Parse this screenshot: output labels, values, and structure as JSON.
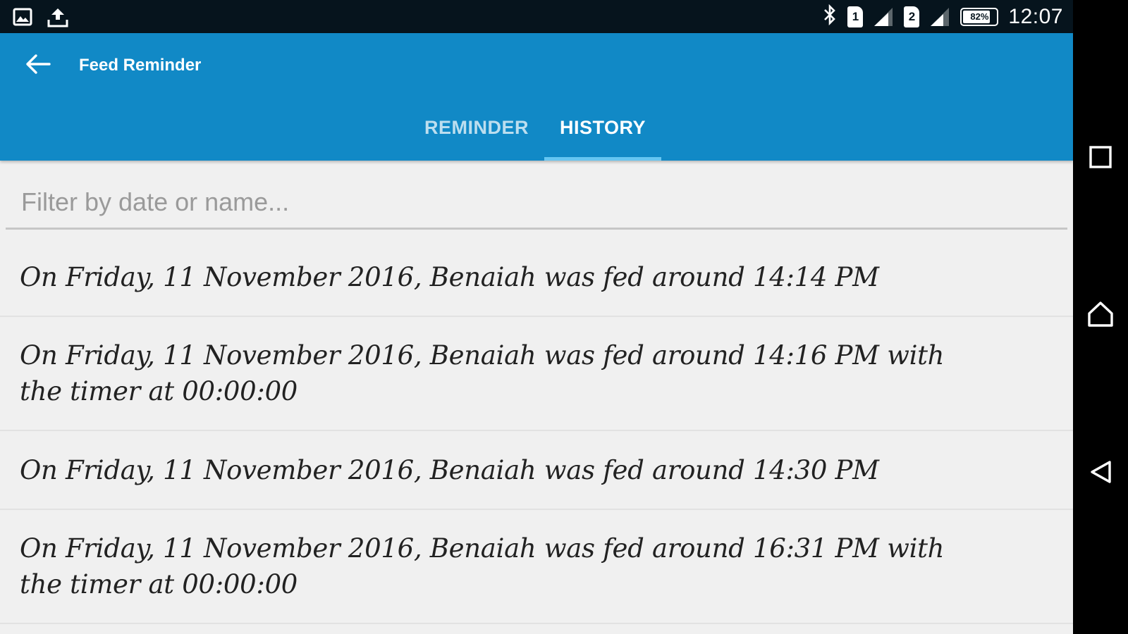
{
  "status_bar": {
    "time": "12:07",
    "battery_percent": "82%",
    "battery_level": 0.82,
    "sim1_label": "1",
    "sim2_label": "2",
    "icons": [
      "image-icon",
      "upload-icon",
      "bluetooth-icon",
      "sim1-icon",
      "signal1-icon",
      "sim2-icon",
      "signal2-icon",
      "battery-icon"
    ]
  },
  "app_bar": {
    "title": "Feed Reminder",
    "background_color": "#1189c6",
    "back_icon": "arrow-left-icon"
  },
  "tabs": [
    {
      "label": "REMINDER",
      "active": false
    },
    {
      "label": "HISTORY",
      "active": true
    }
  ],
  "filter": {
    "placeholder": "Filter by date or name...",
    "value": ""
  },
  "history": [
    {
      "text": "On Friday, 11 November 2016, Benaiah was fed around 14:14 PM"
    },
    {
      "text": "On Friday, 11 November 2016, Benaiah was fed around 14:16 PM with the timer at 00:00:00"
    },
    {
      "text": "On Friday, 11 November 2016, Benaiah was fed around 14:30 PM"
    },
    {
      "text": "On Friday, 11 November 2016, Benaiah was fed around 16:31 PM with the timer at 00:00:00"
    }
  ],
  "nav_bar": {
    "icons": [
      "recents-icon",
      "home-icon",
      "back-triangle-icon"
    ]
  }
}
